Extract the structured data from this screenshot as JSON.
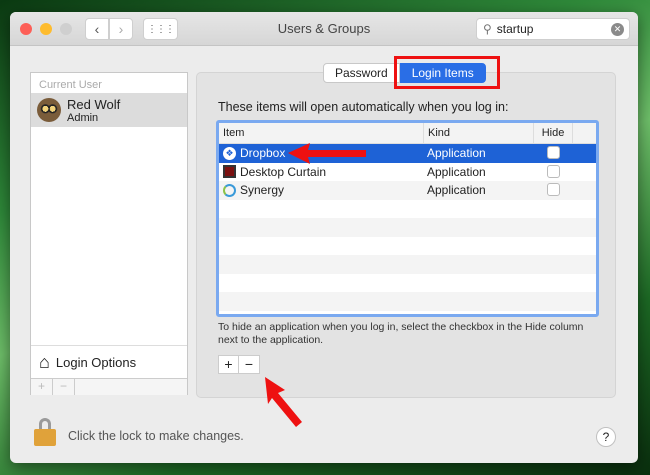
{
  "window": {
    "title": "Users & Groups"
  },
  "search": {
    "value": "startup"
  },
  "sidebar": {
    "section": "Current User",
    "user": {
      "name": "Red Wolf",
      "role": "Admin"
    },
    "login_options": "Login Options",
    "add": "+",
    "remove": "−"
  },
  "tabs": [
    {
      "label": "Password",
      "active": false
    },
    {
      "label": "Login Items",
      "active": true
    }
  ],
  "main": {
    "intro": "These items will open automatically when you log in:",
    "columns": [
      "Item",
      "Kind",
      "Hide"
    ],
    "rows": [
      {
        "item": "Dropbox",
        "kind": "Application",
        "hide": false,
        "selected": true
      },
      {
        "item": "Desktop Curtain",
        "kind": "Application",
        "hide": false,
        "selected": false
      },
      {
        "item": "Synergy",
        "kind": "Application",
        "hide": false,
        "selected": false
      }
    ],
    "note": "To hide an application when you log in, select the checkbox in the Hide column next to the application.",
    "add": "+",
    "remove": "−"
  },
  "footer": {
    "lock_text": "Click the lock to make changes.",
    "help": "?"
  },
  "colors": {
    "accent": "#2a6ee6",
    "annotation": "#e11111"
  }
}
